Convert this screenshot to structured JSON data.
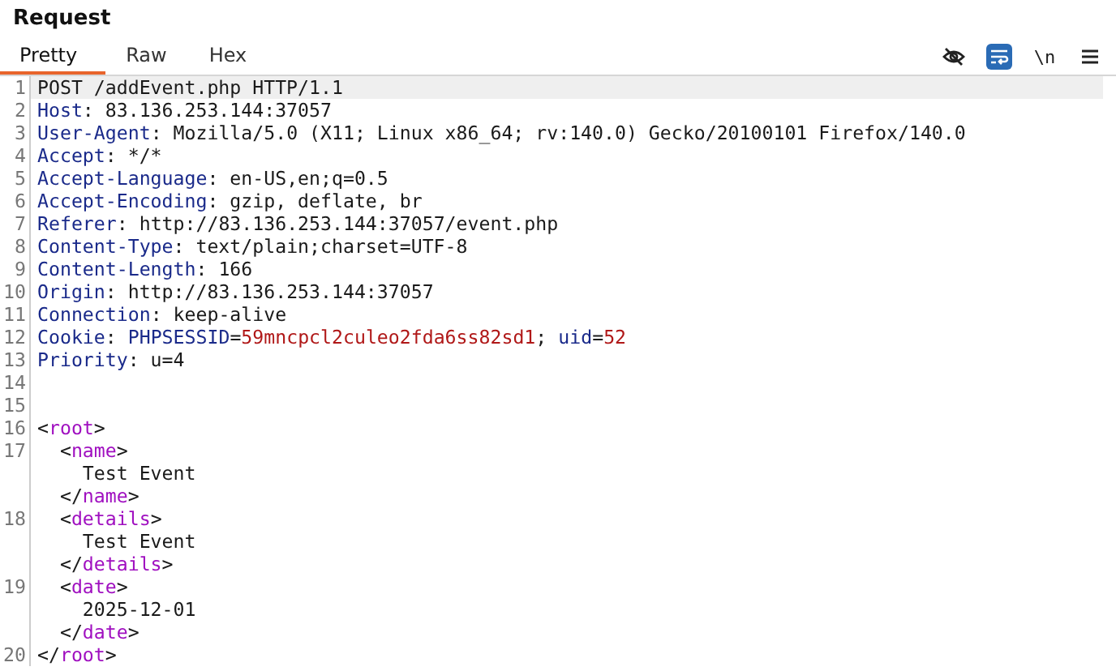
{
  "title": "Request",
  "tabs": [
    {
      "label": "Pretty",
      "selected": true
    },
    {
      "label": "Raw",
      "selected": false
    },
    {
      "label": "Hex",
      "selected": false
    }
  ],
  "toolbar": [
    {
      "kind": "hide",
      "on": false
    },
    {
      "kind": "wrap",
      "on": true
    },
    {
      "kind": "newline",
      "text": "\\n",
      "on": false
    },
    {
      "kind": "menu",
      "on": false
    }
  ],
  "lines": [
    {
      "number": "1",
      "current": true,
      "parts": [
        {
          "kind": "text",
          "text": "POST /addEvent.php HTTP/1.1"
        }
      ]
    },
    {
      "number": "2",
      "parts": [
        {
          "kind": "name",
          "text": "Host"
        },
        {
          "kind": "text",
          "text": ": 83.136.253.144:37057"
        }
      ]
    },
    {
      "number": "3",
      "parts": [
        {
          "kind": "name",
          "text": "User-Agent"
        },
        {
          "kind": "text",
          "text": ": Mozilla/5.0 (X11; Linux x86_64; rv:140.0) Gecko/20100101 Firefox/140.0"
        }
      ]
    },
    {
      "number": "4",
      "parts": [
        {
          "kind": "name",
          "text": "Accept"
        },
        {
          "kind": "text",
          "text": ": */*"
        }
      ]
    },
    {
      "number": "5",
      "parts": [
        {
          "kind": "name",
          "text": "Accept-Language"
        },
        {
          "kind": "text",
          "text": ": en-US,en;q=0.5"
        }
      ]
    },
    {
      "number": "6",
      "parts": [
        {
          "kind": "name",
          "text": "Accept-Encoding"
        },
        {
          "kind": "text",
          "text": ": gzip, deflate, br"
        }
      ]
    },
    {
      "number": "7",
      "parts": [
        {
          "kind": "name",
          "text": "Referer"
        },
        {
          "kind": "text",
          "text": ": http://83.136.253.144:37057/event.php"
        }
      ]
    },
    {
      "number": "8",
      "parts": [
        {
          "kind": "name",
          "text": "Content-Type"
        },
        {
          "kind": "text",
          "text": ": text/plain;charset=UTF-8"
        }
      ]
    },
    {
      "number": "9",
      "parts": [
        {
          "kind": "name",
          "text": "Content-Length"
        },
        {
          "kind": "text",
          "text": ": 166"
        }
      ]
    },
    {
      "number": "10",
      "parts": [
        {
          "kind": "name",
          "text": "Origin"
        },
        {
          "kind": "text",
          "text": ": http://83.136.253.144:37057"
        }
      ]
    },
    {
      "number": "11",
      "parts": [
        {
          "kind": "name",
          "text": "Connection"
        },
        {
          "kind": "text",
          "text": ": keep-alive"
        }
      ]
    },
    {
      "number": "12",
      "parts": [
        {
          "kind": "name",
          "text": "Cookie"
        },
        {
          "kind": "text",
          "text": ": "
        },
        {
          "kind": "name",
          "text": "PHPSESSID"
        },
        {
          "kind": "text",
          "text": "="
        },
        {
          "kind": "value",
          "text": "59mncpcl2culeo2fda6ss82sd1"
        },
        {
          "kind": "text",
          "text": "; "
        },
        {
          "kind": "name",
          "text": "uid"
        },
        {
          "kind": "text",
          "text": "="
        },
        {
          "kind": "value",
          "text": "52"
        }
      ]
    },
    {
      "number": "13",
      "parts": [
        {
          "kind": "name",
          "text": "Priority"
        },
        {
          "kind": "text",
          "text": ": u=4"
        }
      ]
    },
    {
      "number": "14"
    },
    {
      "number": "15"
    },
    {
      "number": "16",
      "parts": [
        {
          "kind": "text",
          "text": "<"
        },
        {
          "kind": "tag",
          "text": "root"
        },
        {
          "kind": "text",
          "text": ">"
        }
      ]
    },
    {
      "number": "17",
      "parts": [
        {
          "kind": "text",
          "text": "  <"
        },
        {
          "kind": "tag",
          "text": "name"
        },
        {
          "kind": "text",
          "text": ">"
        }
      ]
    },
    {
      "parts": [
        {
          "kind": "text",
          "text": "    Test Event"
        }
      ]
    },
    {
      "parts": [
        {
          "kind": "text",
          "text": "  </"
        },
        {
          "kind": "tag",
          "text": "name"
        },
        {
          "kind": "text",
          "text": ">"
        }
      ]
    },
    {
      "number": "18",
      "parts": [
        {
          "kind": "text",
          "text": "  <"
        },
        {
          "kind": "tag",
          "text": "details"
        },
        {
          "kind": "text",
          "text": ">"
        }
      ]
    },
    {
      "parts": [
        {
          "kind": "text",
          "text": "    Test Event"
        }
      ]
    },
    {
      "parts": [
        {
          "kind": "text",
          "text": "  </"
        },
        {
          "kind": "tag",
          "text": "details"
        },
        {
          "kind": "text",
          "text": ">"
        }
      ]
    },
    {
      "number": "19",
      "parts": [
        {
          "kind": "text",
          "text": "  <"
        },
        {
          "kind": "tag",
          "text": "date"
        },
        {
          "kind": "text",
          "text": ">"
        }
      ]
    },
    {
      "parts": [
        {
          "kind": "text",
          "text": "    2025-12-01"
        }
      ]
    },
    {
      "parts": [
        {
          "kind": "text",
          "text": "  </"
        },
        {
          "kind": "tag",
          "text": "date"
        },
        {
          "kind": "text",
          "text": ">"
        }
      ]
    },
    {
      "number": "20",
      "parts": [
        {
          "kind": "text",
          "text": "</"
        },
        {
          "kind": "tag",
          "text": "root"
        },
        {
          "kind": "text",
          "text": ">"
        }
      ]
    }
  ]
}
